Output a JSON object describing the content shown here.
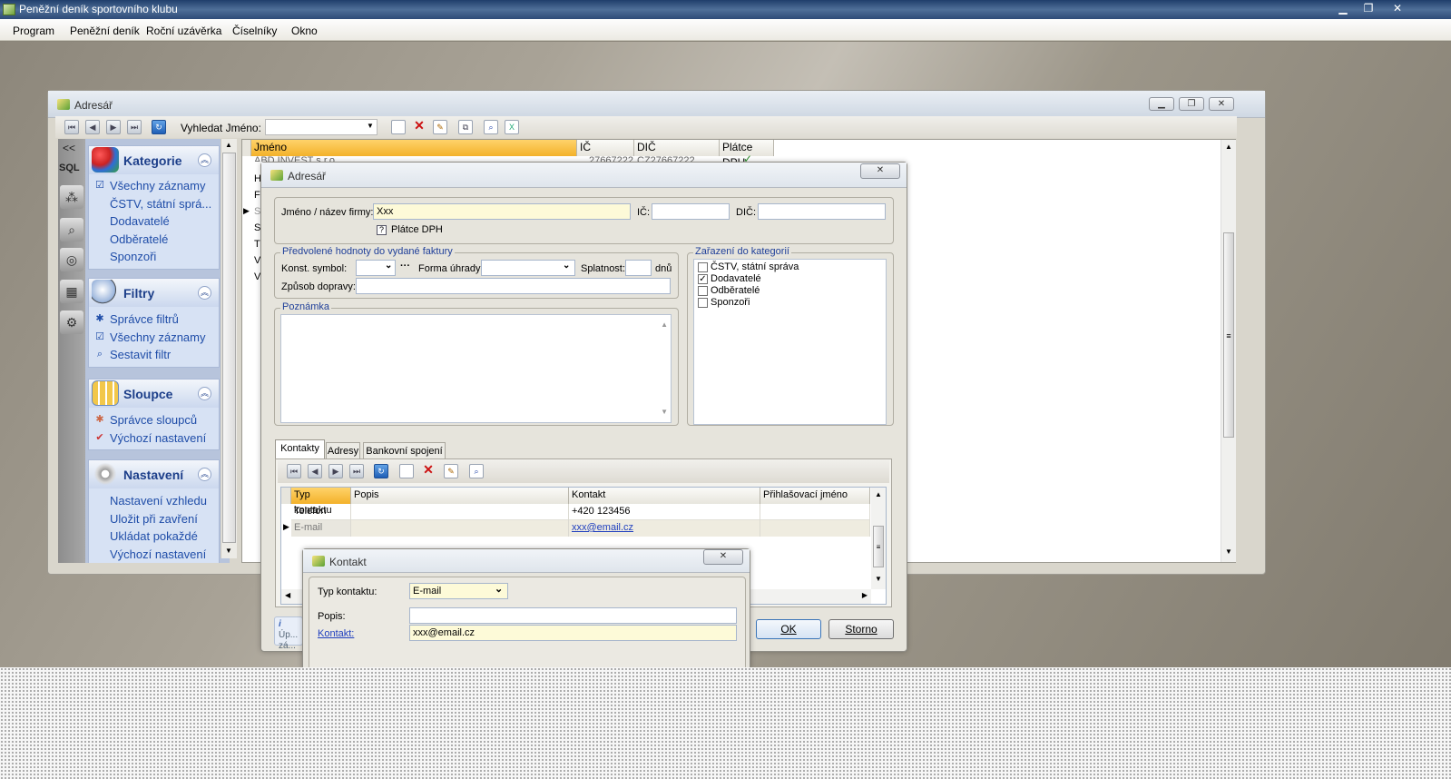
{
  "app": {
    "title": "Peněžní deník sportovního klubu"
  },
  "menu": [
    "Program",
    "Peněžní deník",
    "Roční uzávěrka",
    "Číselníky",
    "Okno"
  ],
  "address_window": {
    "title": "Adresář",
    "search_label": "Vyhledat Jméno:",
    "strip": {
      "collapse": "<<",
      "sql": "SQL"
    },
    "groups": [
      {
        "title": "Kategorie",
        "items": [
          "Všechny záznamy",
          "ČSTV, státní sprá...",
          "Dodavatelé",
          "Odběratelé",
          "Sponzoři"
        ]
      },
      {
        "title": "Filtry",
        "items": [
          "Správce filtrů",
          "Všechny záznamy",
          "Sestavit filtr"
        ]
      },
      {
        "title": "Sloupce",
        "items": [
          "Správce sloupců",
          "Výchozí nastavení"
        ]
      },
      {
        "title": "Nastavení",
        "items": [
          "Nastavení vzhledu",
          "Uložit při zavření",
          "Ukládat pokaždé",
          "Výchozí nastavení"
        ]
      }
    ],
    "grid_columns": [
      "Jméno",
      "IČ",
      "DIČ",
      "Plátce DPH"
    ],
    "grid_row_peek": {
      "name": "ABD INVEST s.r.o.",
      "ic": "27667222",
      "dic": "CZ27667222"
    },
    "row_initials": [
      "H",
      "F",
      "S",
      "S",
      "T",
      "V",
      "V"
    ]
  },
  "edit_dialog": {
    "title": "Adresář",
    "name_label": "Jméno / název firmy:",
    "name_value": "Xxx",
    "ic_label": "IČ:",
    "dic_label": "DIČ:",
    "vat_payer": "Plátce DPH",
    "defaults_legend": "Předvolené hodnoty do vydané faktury",
    "konst_label": "Konst. symbol:",
    "forma_label": "Forma úhrady:",
    "splatnost_label": "Splatnost:",
    "splatnost_unit": "dnů",
    "doprava_label": "Způsob dopravy:",
    "note_legend": "Poznámka",
    "categories_legend": "Zařazení do kategorií",
    "categories": [
      {
        "label": "ČSTV, státní správa",
        "checked": false
      },
      {
        "label": "Dodavatelé",
        "checked": true
      },
      {
        "label": "Odběratelé",
        "checked": false
      },
      {
        "label": "Sponzoři",
        "checked": false
      }
    ],
    "tabs": [
      "Kontakty",
      "Adresy",
      "Bankovní spojení"
    ],
    "contact_columns": [
      "Typ kontaktu",
      "Popis",
      "Kontakt",
      "Přihlašovací jméno"
    ],
    "contacts": [
      {
        "type": "Telefon",
        "desc": "",
        "contact": "+420 123456",
        "login": ""
      },
      {
        "type": "E-mail",
        "desc": "",
        "contact": "xxx@email.cz",
        "login": ""
      }
    ],
    "hint": "Úp... zá...",
    "ok": "OK",
    "cancel": "Storno"
  },
  "contact_dialog": {
    "title": "Kontakt",
    "type_label": "Typ kontaktu:",
    "type_value": "E-mail",
    "desc_label": "Popis:",
    "desc_value": "",
    "contact_label": "Kontakt:",
    "contact_value": "xxx@email.cz"
  }
}
